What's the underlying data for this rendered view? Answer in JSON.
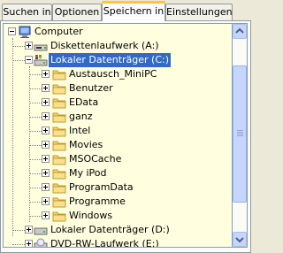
{
  "tabs": [
    {
      "label": "Suchen in",
      "active": false
    },
    {
      "label": "Optionen",
      "active": false
    },
    {
      "label": "Speichern in",
      "active": true
    },
    {
      "label": "Einstellungen",
      "active": false
    }
  ],
  "tree": {
    "root": {
      "label": "Computer",
      "icon": "computer-icon",
      "expanded": true
    },
    "drives": [
      {
        "label": "Diskettenlaufwerk (A:)",
        "icon": "floppy-drive-icon",
        "expanded": false
      },
      {
        "label": "Lokaler Datenträger (C:)",
        "icon": "local-drive-icon",
        "expanded": true,
        "selected": true
      },
      {
        "label": "Lokaler Datenträger (D:)",
        "icon": "local-drive-icon",
        "expanded": false
      },
      {
        "label": "DVD-RW-Laufwerk (E:)",
        "icon": "dvd-drive-icon",
        "expanded": false
      }
    ],
    "folders": [
      {
        "label": "Austausch_MiniPC"
      },
      {
        "label": "Benutzer"
      },
      {
        "label": "EData"
      },
      {
        "label": "ganz"
      },
      {
        "label": "Intel"
      },
      {
        "label": "Movies"
      },
      {
        "label": "MSOCache"
      },
      {
        "label": "My iPod"
      },
      {
        "label": "ProgramData"
      },
      {
        "label": "Programme"
      },
      {
        "label": "Windows"
      }
    ]
  },
  "scrollbar": {
    "position": 0.22,
    "visible_fraction": 0.72
  },
  "colors": {
    "tree_bg": "#ffffdf",
    "selection": "#316ac5",
    "active_tab_highlight": "#ffc83c"
  }
}
